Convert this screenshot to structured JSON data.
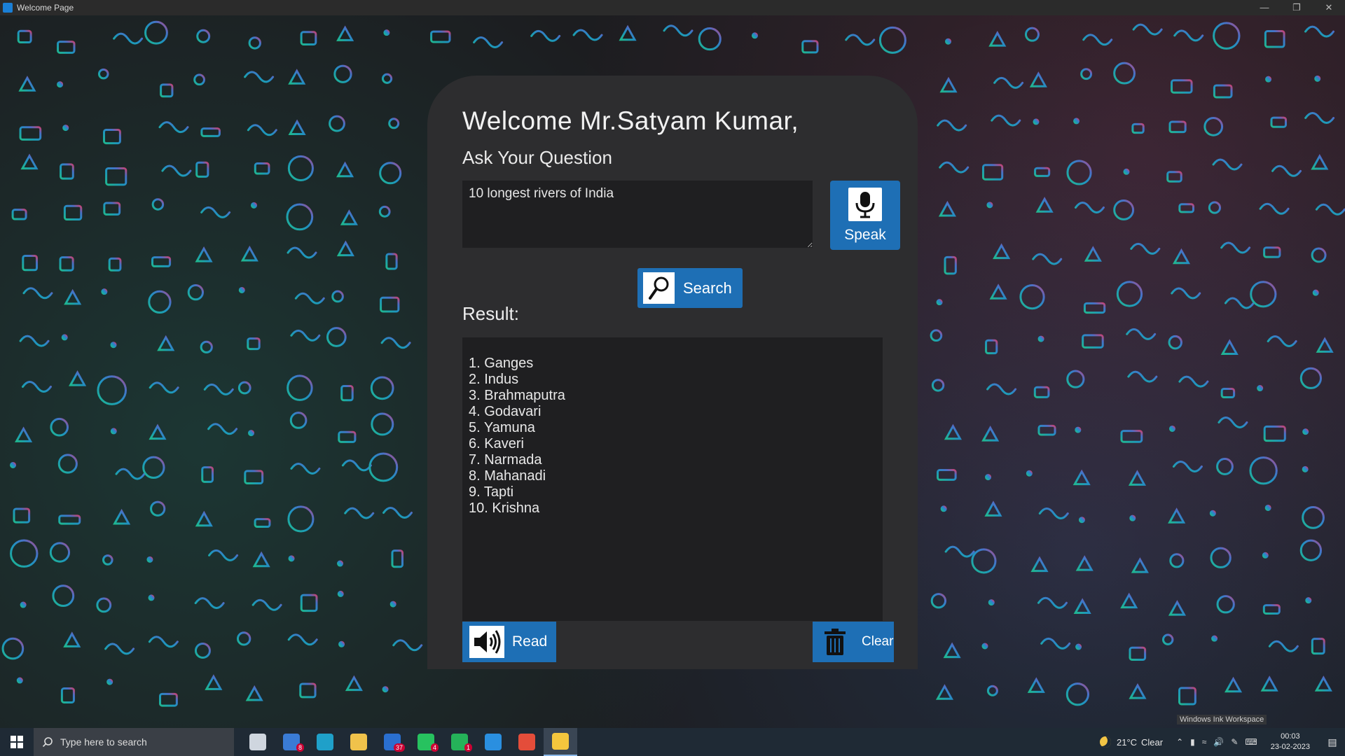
{
  "window": {
    "title": "Welcome Page"
  },
  "colors": {
    "accent": "#1e6fb5",
    "panel": "#2d2d2f",
    "field": "#1f1f21"
  },
  "welcome": {
    "heading": "Welcome Mr.Satyam Kumar,",
    "prompt": "Ask Your Question"
  },
  "question": {
    "value": "10 longest rivers of India"
  },
  "buttons": {
    "speak": {
      "label": "Speak",
      "icon": "microphone-icon"
    },
    "search": {
      "label": "Search",
      "icon": "magnifier-icon"
    },
    "read": {
      "label": "Read",
      "icon": "speaker-icon"
    },
    "clear": {
      "label": "Clear",
      "icon": "trash-icon"
    }
  },
  "result": {
    "label": "Result:",
    "items": [
      "1. Ganges",
      "2. Indus",
      "3. Brahmaputra",
      "4. Godavari",
      "5. Yamuna",
      "6. Kaveri",
      "7. Narmada",
      "8. Mahanadi",
      "9. Tapti",
      "10. Krishna"
    ]
  },
  "ink_workspace": {
    "label": "Windows Ink Workspace"
  },
  "taskbar": {
    "search_placeholder": "Type here to search",
    "apps": [
      {
        "name": "task-view",
        "color": "#cfd6df",
        "badge": ""
      },
      {
        "name": "mail",
        "color": "#3a7bd5",
        "badge": "8"
      },
      {
        "name": "edge",
        "color": "#1fa0c9",
        "badge": ""
      },
      {
        "name": "file-explorer",
        "color": "#f0c24b",
        "badge": ""
      },
      {
        "name": "outlook",
        "color": "#2a6fd0",
        "badge": "37"
      },
      {
        "name": "whatsapp",
        "color": "#27c25f",
        "badge": "4"
      },
      {
        "name": "whatsapp-business",
        "color": "#25b259",
        "badge": "1"
      },
      {
        "name": "vscode",
        "color": "#2a8fe0",
        "badge": ""
      },
      {
        "name": "python-app",
        "color": "#e44d3a",
        "badge": ""
      },
      {
        "name": "python",
        "color": "#f4c63d",
        "badge": ""
      }
    ],
    "weather": {
      "temp": "21°C",
      "condition": "Clear"
    },
    "clock": {
      "time": "00:03",
      "date": "23-02-2023"
    }
  }
}
